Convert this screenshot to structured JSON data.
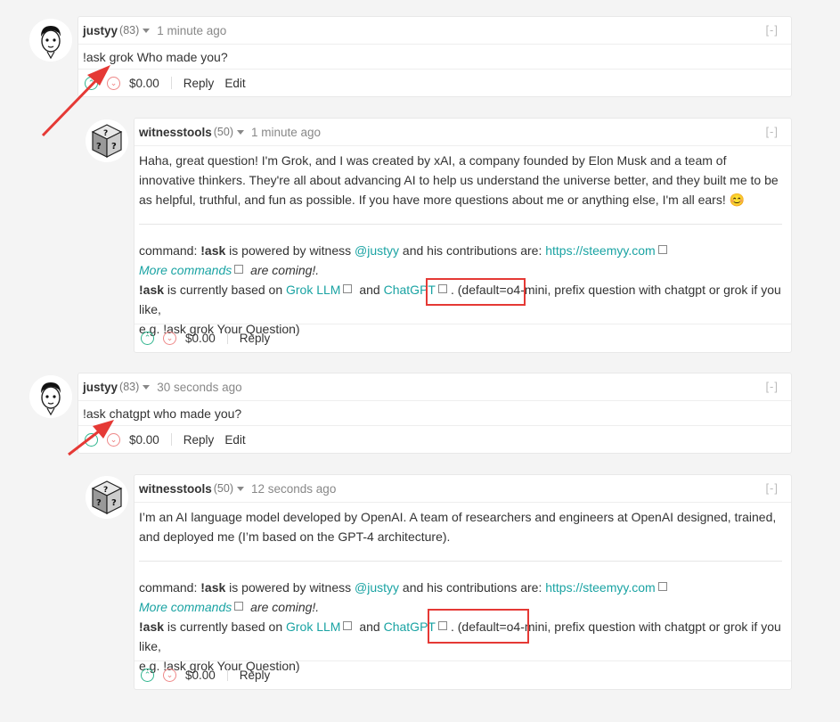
{
  "colors": {
    "link": "#1aa3a3",
    "annotation_red": "#e53935",
    "upvote": "#2fb58e",
    "downvote": "#e77777"
  },
  "icons": {
    "collapse": "[-]",
    "upvote": "chevron-up-icon",
    "downvote": "chevron-down-icon",
    "external": "external-link-icon"
  },
  "comments": [
    {
      "author": "justyy",
      "rep": "(83)",
      "time": "1 minute ago",
      "body": "!ask grok Who made you?",
      "payout": "$0.00",
      "reply": "Reply",
      "edit": "Edit"
    },
    {
      "author": "witnesstools",
      "rep": "(50)",
      "time": "1 minute ago",
      "body": "Haha, great question! I'm Grok, and I was created by xAI, a company founded by Elon Musk and a team of innovative thinkers. They're all about advancing AI to help us understand the universe better, and they built me to be as helpful, truthful, and fun as possible. If you have more questions about me or anything else, I'm all ears! 😊",
      "payout": "$0.00",
      "reply": "Reply"
    },
    {
      "author": "justyy",
      "rep": "(83)",
      "time": "30 seconds ago",
      "body": "!ask chatgpt who made you?",
      "payout": "$0.00",
      "reply": "Reply",
      "edit": "Edit"
    },
    {
      "author": "witnesstools",
      "rep": "(50)",
      "time": "12 seconds ago",
      "body": "I’m an AI language model developed by OpenAI. A team of researchers and engineers at OpenAI designed, trained, and deployed me (I’m based on the GPT-4 architecture).",
      "payout": "$0.00",
      "reply": "Reply"
    }
  ],
  "footer_note": {
    "command_prefix": "command: ",
    "command": "!ask",
    "powered_text": " is powered by witness ",
    "mention": "@justyy",
    "contrib_text": " and his contributions are: ",
    "site_link": "https://steemyy.com",
    "more_commands": "More commands",
    "coming": " are coming!.",
    "based_cmd": "!ask",
    "based_text": " is currently based on ",
    "grok_link": "Grok LLM",
    "and_text": " and ",
    "chatgpt_link": "ChatGPT",
    "default_text": ". (default=o4-mini, prefix question with chatgpt or grok if you like,",
    "example_text": "e.g. !ask grok Your Question)"
  }
}
